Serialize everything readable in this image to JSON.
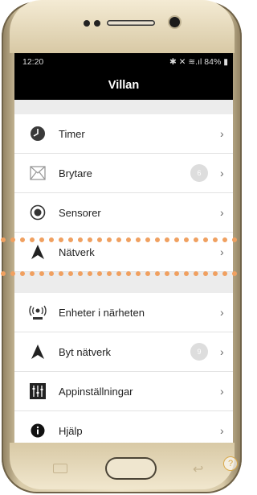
{
  "status_bar": {
    "time": "12:20",
    "icons": "✱ ✕ ≋.ıl",
    "battery": "84%"
  },
  "app": {
    "title": "Villan"
  },
  "menu_group1": [
    {
      "label": "Timer",
      "icon": "clock-icon",
      "badge": ""
    },
    {
      "label": "Brytare",
      "icon": "switch-envelope-icon",
      "badge": "6"
    },
    {
      "label": "Sensorer",
      "icon": "sensor-icon",
      "badge": ""
    },
    {
      "label": "Nätverk",
      "icon": "network-icon",
      "badge": ""
    }
  ],
  "menu_group2": [
    {
      "label": "Enheter i närheten",
      "icon": "nearby-devices-icon",
      "badge": ""
    },
    {
      "label": "Byt nätverk",
      "icon": "network-icon",
      "badge": "9"
    },
    {
      "label": "Appinställningar",
      "icon": "sliders-icon",
      "badge": ""
    },
    {
      "label": "Hjälp",
      "icon": "info-icon",
      "badge": ""
    }
  ],
  "help_fab": "?",
  "colors": {
    "highlight_dots": "#f0a060"
  }
}
